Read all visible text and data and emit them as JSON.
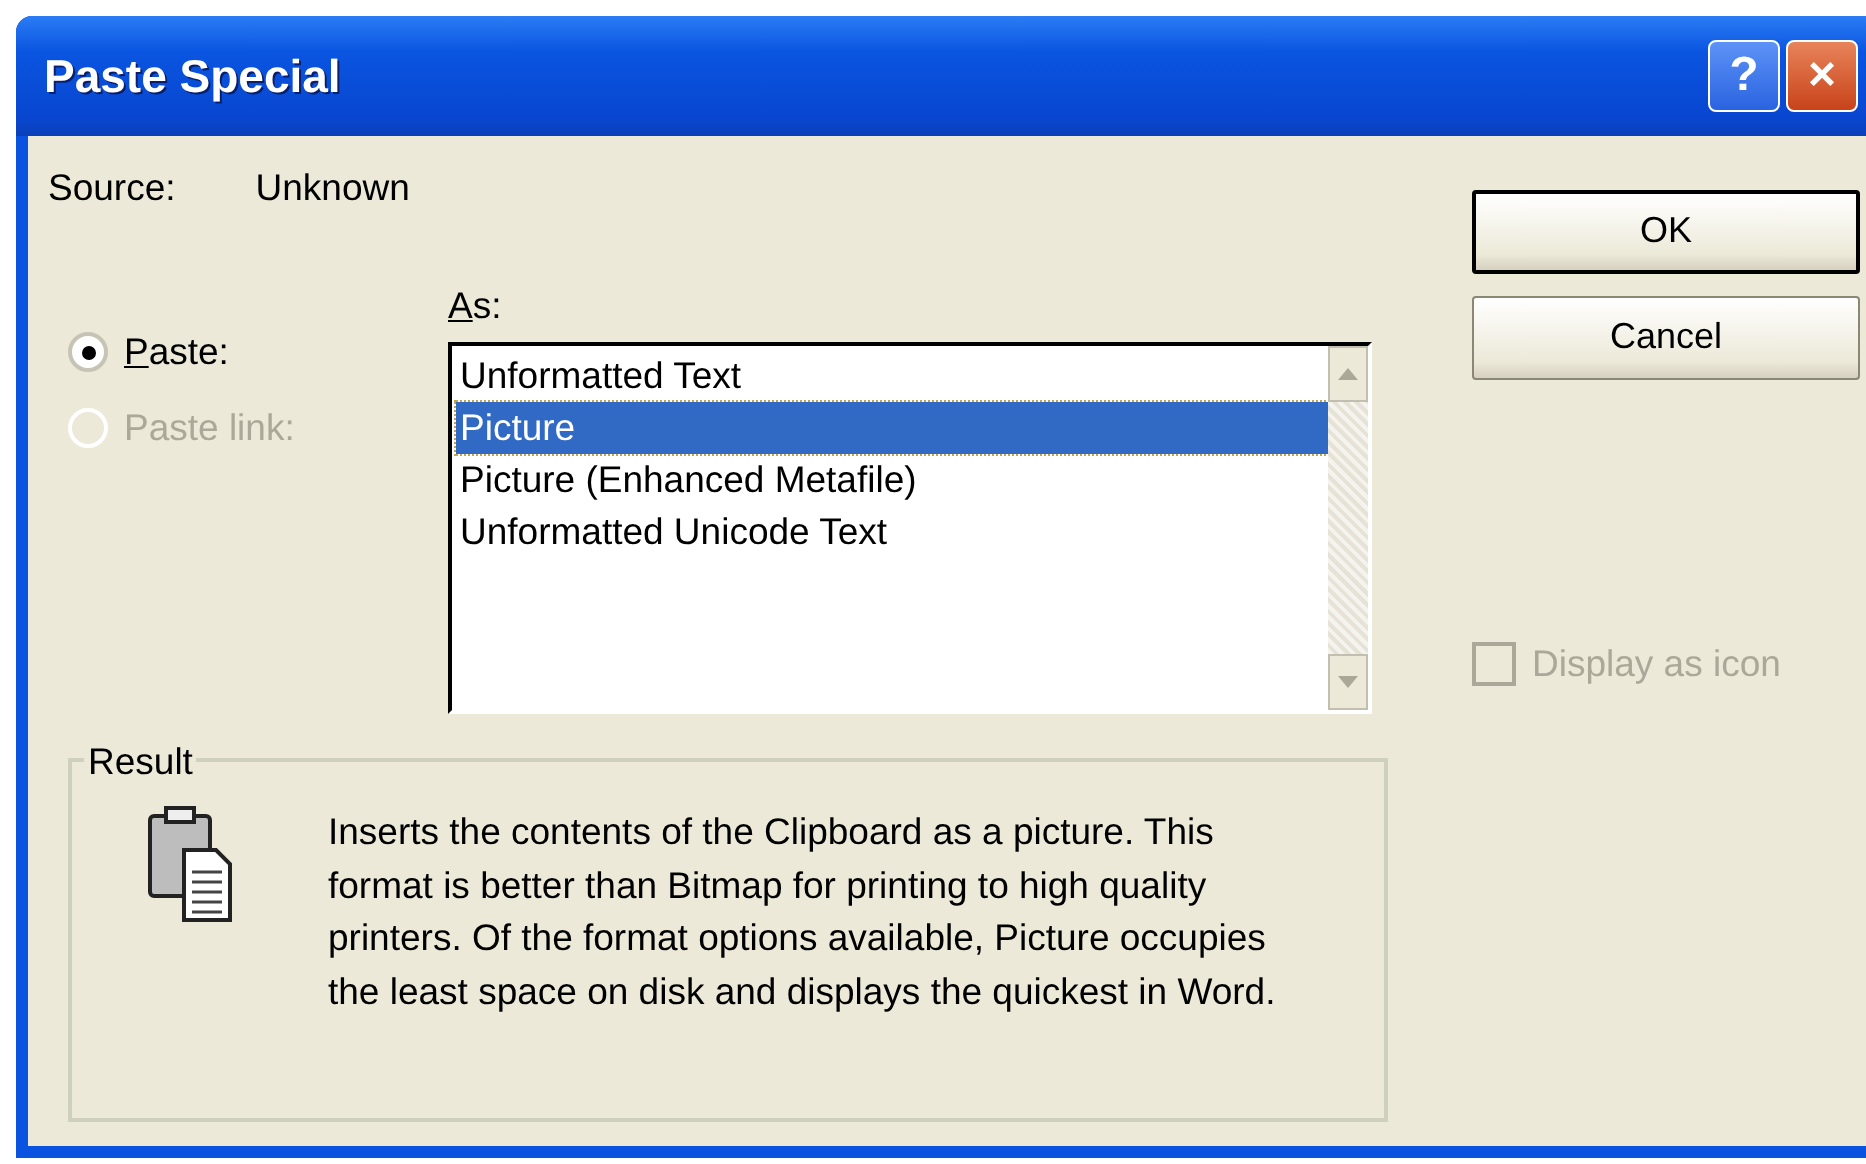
{
  "window": {
    "title": "Paste Special",
    "title_buttons": [
      {
        "kind": "help",
        "label": "?"
      },
      {
        "kind": "close",
        "label": "×"
      }
    ]
  },
  "source": {
    "label": "Source:",
    "value": "Unknown"
  },
  "as_label": {
    "text": "As:",
    "underline_first": true
  },
  "paste_options": [
    {
      "label": "Paste:",
      "underline_first": true,
      "selected": true,
      "disabled": false
    },
    {
      "label": "Paste link:",
      "selected": false,
      "disabled": true
    }
  ],
  "formats": [
    {
      "label": "Unformatted Text",
      "selected": false
    },
    {
      "label": "Picture",
      "selected": true
    },
    {
      "label": "Picture (Enhanced Metafile)",
      "selected": false
    },
    {
      "label": "Unformatted Unicode Text",
      "selected": false
    }
  ],
  "result": {
    "title": "Result",
    "description": "Inserts the contents of the Clipboard as a picture. This format is better than Bitmap for printing to high quality printers. Of the format options available, Picture occupies the least space on disk and displays the quickest in Word."
  },
  "buttons": [
    {
      "label": "OK",
      "default": true
    },
    {
      "label": "Cancel",
      "default": false
    }
  ],
  "display_as_icon": {
    "label": "Display as icon",
    "checked": false,
    "disabled": true
  }
}
